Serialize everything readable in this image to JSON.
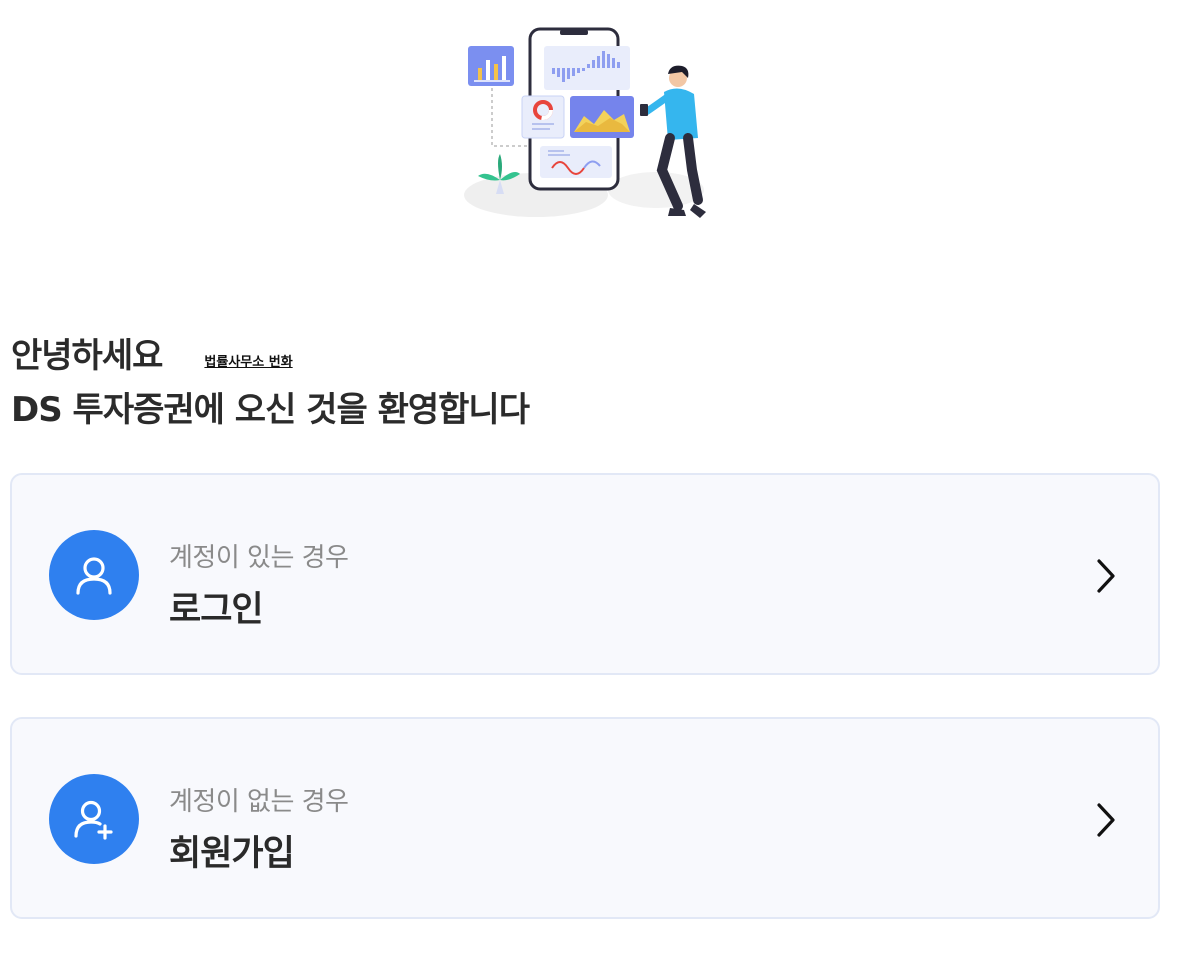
{
  "greeting": {
    "hello": "안녕하세요",
    "law_link": "법률사무소 번화",
    "welcome": "DS 투자증권에 오신 것을 환영합니다"
  },
  "cards": [
    {
      "sub": "계정이 있는 경우",
      "label": "로그인",
      "icon": "user-icon",
      "arrow": "chevron-right-icon"
    },
    {
      "sub": "계정이 없는 경우",
      "label": "회원가입",
      "icon": "user-plus-icon",
      "arrow": "chevron-right-icon"
    }
  ],
  "colors": {
    "accent": "#2f80ef",
    "card_bg": "#f8f9fd",
    "card_border": "#e2e8f6",
    "sub_text": "#8a8a8a",
    "main_text": "#2a2a2a"
  },
  "hero_icon": "mobile-analytics-illustration"
}
